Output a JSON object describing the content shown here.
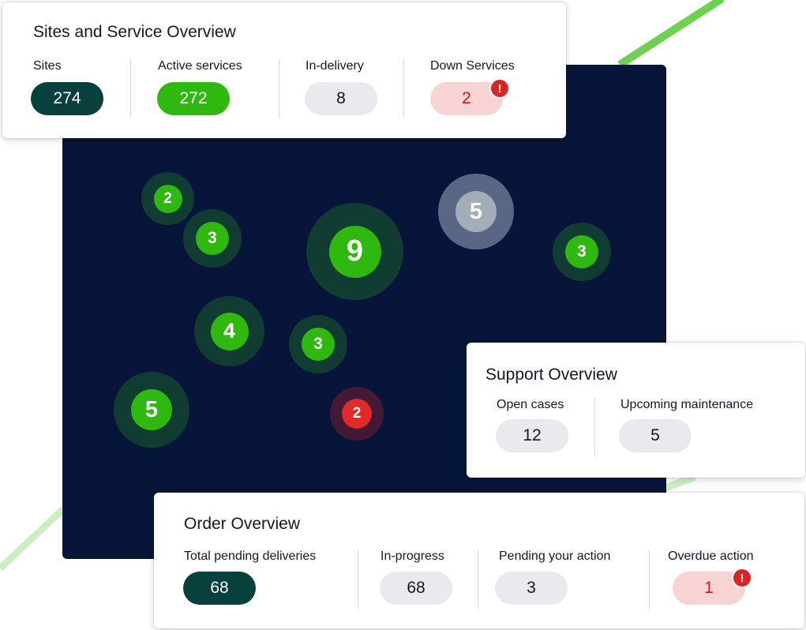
{
  "colors": {
    "map_background": "#08153a",
    "accent_green": "#2fb80f",
    "dark_teal": "#08403d",
    "alert_red": "#dc2424"
  },
  "sites_overview": {
    "title": "Sites and Service Overview",
    "metrics": [
      {
        "label": "Sites",
        "value": "274"
      },
      {
        "label": "Active services",
        "value": "272"
      },
      {
        "label": "In-delivery",
        "value": "8"
      },
      {
        "label": "Down Services",
        "value": "2",
        "alert": "!"
      }
    ]
  },
  "map": {
    "clusters": [
      {
        "count": "2",
        "status": "green"
      },
      {
        "count": "3",
        "status": "green"
      },
      {
        "count": "9",
        "status": "green"
      },
      {
        "count": "5",
        "status": "grey"
      },
      {
        "count": "3",
        "status": "green"
      },
      {
        "count": "4",
        "status": "green"
      },
      {
        "count": "3",
        "status": "green"
      },
      {
        "count": "5",
        "status": "green"
      },
      {
        "count": "2",
        "status": "red"
      }
    ]
  },
  "support_overview": {
    "title": "Support Overview",
    "metrics": [
      {
        "label": "Open cases",
        "value": "12"
      },
      {
        "label": "Upcoming maintenance",
        "value": "5"
      }
    ]
  },
  "order_overview": {
    "title": "Order Overview",
    "metrics": [
      {
        "label": "Total pending deliveries",
        "value": "68"
      },
      {
        "label": "In-progress",
        "value": "68"
      },
      {
        "label": "Pending your action",
        "value": "3"
      },
      {
        "label": "Overdue action",
        "value": "1",
        "alert": "!"
      }
    ]
  }
}
